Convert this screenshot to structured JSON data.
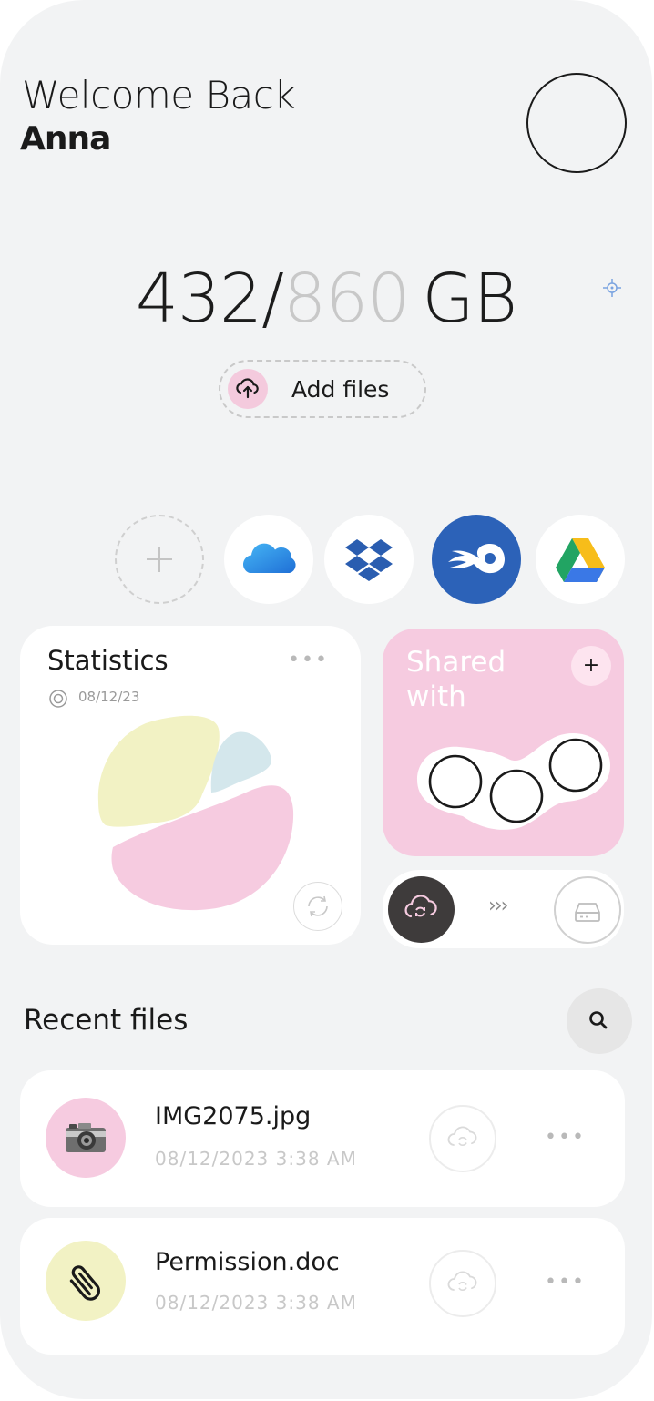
{
  "header": {
    "greeting": "Welcome Back",
    "user_name": "Anna"
  },
  "storage": {
    "used": "432",
    "separator": "/",
    "total": "860",
    "unit": "GB"
  },
  "add_files": {
    "label": "Add files",
    "icon": "cloud-upload-icon"
  },
  "services": [
    {
      "name": "add-service",
      "icon": "plus-icon"
    },
    {
      "name": "icloud",
      "icon": "cloud-icon",
      "color": "#2b8fe6"
    },
    {
      "name": "dropbox",
      "icon": "dropbox-icon",
      "color": "#2a5db0"
    },
    {
      "name": "mediafire",
      "icon": "mediafire-icon",
      "color": "#2c62b8"
    },
    {
      "name": "google-drive",
      "icon": "google-drive-icon",
      "colors": [
        "#f7bd1a",
        "#22a463",
        "#3a78e6"
      ]
    }
  ],
  "statistics": {
    "title": "Statistics",
    "date": "08/12/23",
    "menu": "•••",
    "slices": [
      {
        "name": "yellow",
        "color": "#f2f2c4"
      },
      {
        "name": "blue",
        "color": "#d4e7ec"
      },
      {
        "name": "pink",
        "color": "#f6cbe0"
      }
    ]
  },
  "shared": {
    "title": "Shared with",
    "add_label": "+",
    "color": "#f6cbe0"
  },
  "transfer": {
    "arrows": "›››",
    "from_icon": "cloud-icon",
    "to_icon": "drive-icon"
  },
  "recent": {
    "title": "Recent files",
    "search_icon": "search-icon",
    "files": [
      {
        "name": "IMG2075.jpg",
        "date": "08/12/2023  3:38 AM",
        "icon": "camera-icon",
        "color": "#f6cbe0",
        "menu": "•••"
      },
      {
        "name": "Permission.doc",
        "date": "08/12/2023  3:38 AM",
        "icon": "paperclip-icon",
        "color": "#f2f2c4",
        "menu": "•••"
      }
    ]
  }
}
